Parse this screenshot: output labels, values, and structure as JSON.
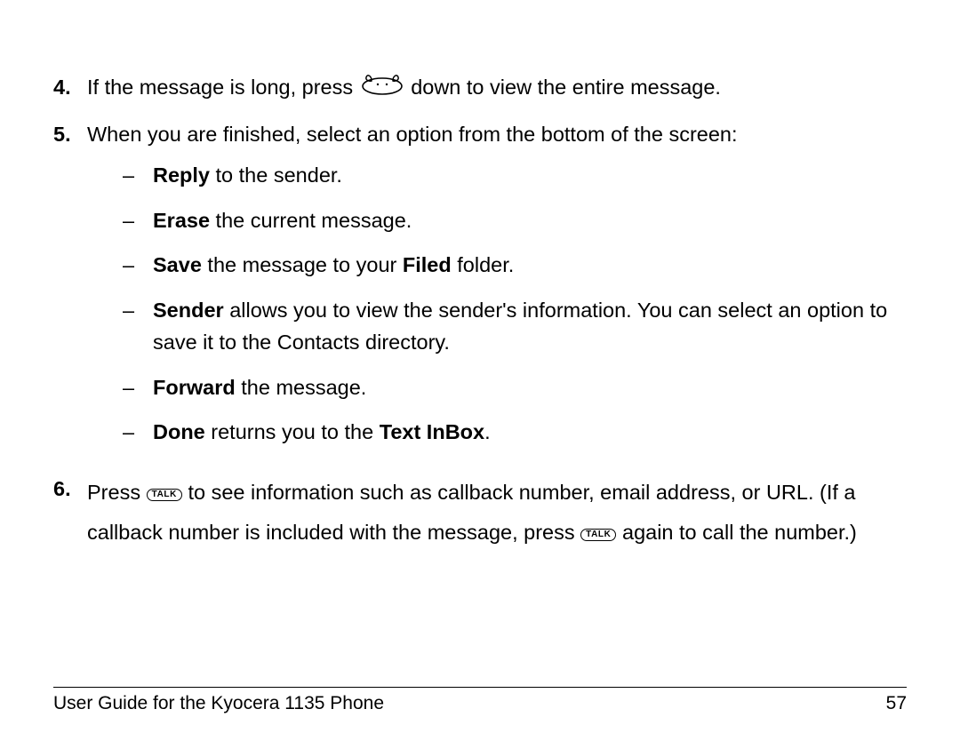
{
  "items": [
    {
      "num": "4.",
      "pre": "If the message is long, press ",
      "post": " down to view the entire message."
    },
    {
      "num": "5.",
      "text": "When you are finished, select an option from the bottom of the screen:",
      "sub": [
        {
          "bold1": "Reply",
          "text1": " to the sender."
        },
        {
          "bold1": "Erase",
          "text1": " the current message."
        },
        {
          "bold1": "Save",
          "text1": " the message to your ",
          "bold2": "Filed",
          "text2": " folder."
        },
        {
          "bold1": "Sender",
          "text1": " allows you to view the sender's information. You can select an option to save it to the Contacts directory."
        },
        {
          "bold1": "Forward",
          "text1": " the message."
        },
        {
          "bold1": "Done",
          "text1": " returns you to the ",
          "bold2": "Text InBox",
          "text2": "."
        }
      ]
    },
    {
      "num": "6.",
      "seg1": "Press ",
      "seg2": " to see information such as callback number, email address, or URL. (If a callback number is included with the message, press ",
      "seg3": " again to call the number.)"
    }
  ],
  "talk_label": "TALK",
  "dash": "–",
  "footer": {
    "title": "User Guide for the Kyocera 1135 Phone",
    "page": "57"
  }
}
